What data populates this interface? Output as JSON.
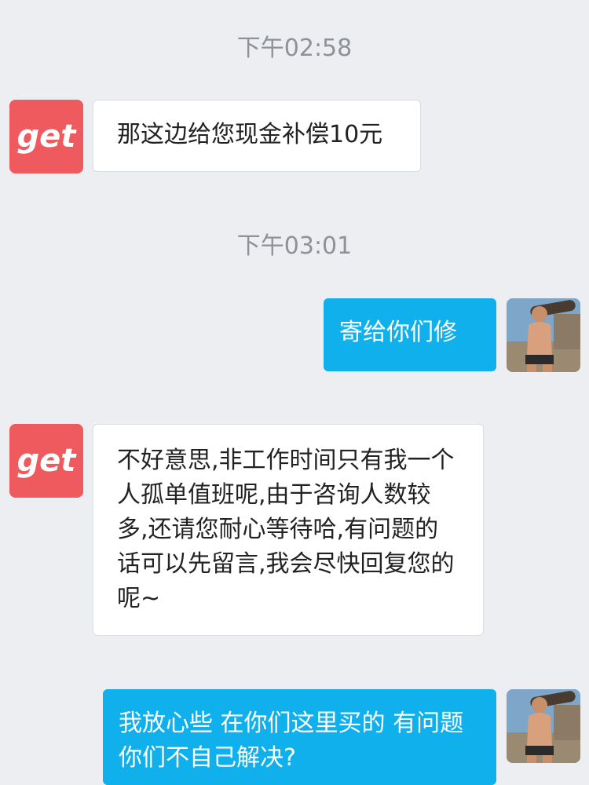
{
  "conversation": {
    "timestamps": [
      "下午02:58",
      "下午03:01"
    ],
    "messages": [
      {
        "sender": "agent",
        "avatar": "get-logo-avatar",
        "text": "那这边给您现金补偿10元"
      },
      {
        "sender": "user",
        "avatar": "user-photo-avatar",
        "text": "寄给你们修"
      },
      {
        "sender": "agent",
        "avatar": "get-logo-avatar",
        "text": "不好意思,非工作时间只有我一个人孤单值班呢,由于咨询人数较多,还请您耐心等待哈,有问题的话可以先留言,我会尽快回复您的呢~"
      },
      {
        "sender": "user",
        "avatar": "user-photo-avatar",
        "text": "我放心些 在你们这里买的 有问题你们不自己解决?"
      }
    ]
  },
  "brand": {
    "logo_text": "get",
    "logo_bg": "#ee5a5d"
  },
  "colors": {
    "background": "#eceef2",
    "outgoing_bubble": "#0fb0ec",
    "incoming_bubble": "#ffffff",
    "timestamp_text": "#8e9196"
  }
}
